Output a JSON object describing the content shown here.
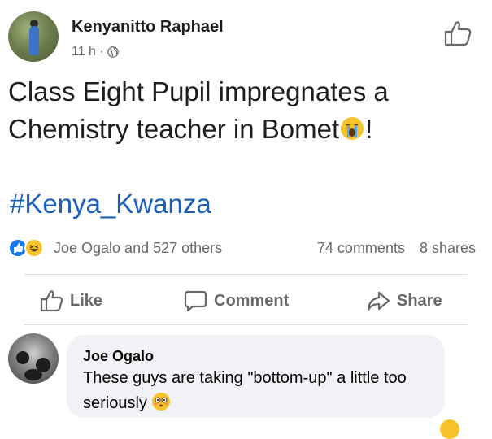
{
  "post": {
    "author": "Kenyanitto Raphael",
    "timestamp": "11 h ·",
    "privacy_icon": "globe-icon",
    "text_part1": "Class Eight Pupil impregnates a Chemistry teacher in Bomet",
    "text_part2": "!",
    "hashtag": "#Kenya_Kwanza"
  },
  "reactions": {
    "names": "Joe Ogalo and 527 others",
    "comments": "74 comments",
    "shares": "8 shares"
  },
  "actions": {
    "like": "Like",
    "comment": "Comment",
    "share": "Share"
  },
  "comment": {
    "author": "Joe Ogalo",
    "text": "These guys are taking \"bottom-up\" a little too seriously"
  },
  "colors": {
    "link": "#1b5fb8",
    "secondary_text": "#65676b",
    "like_blue": "#1877f2",
    "bubble_bg": "#f0f2f5"
  }
}
